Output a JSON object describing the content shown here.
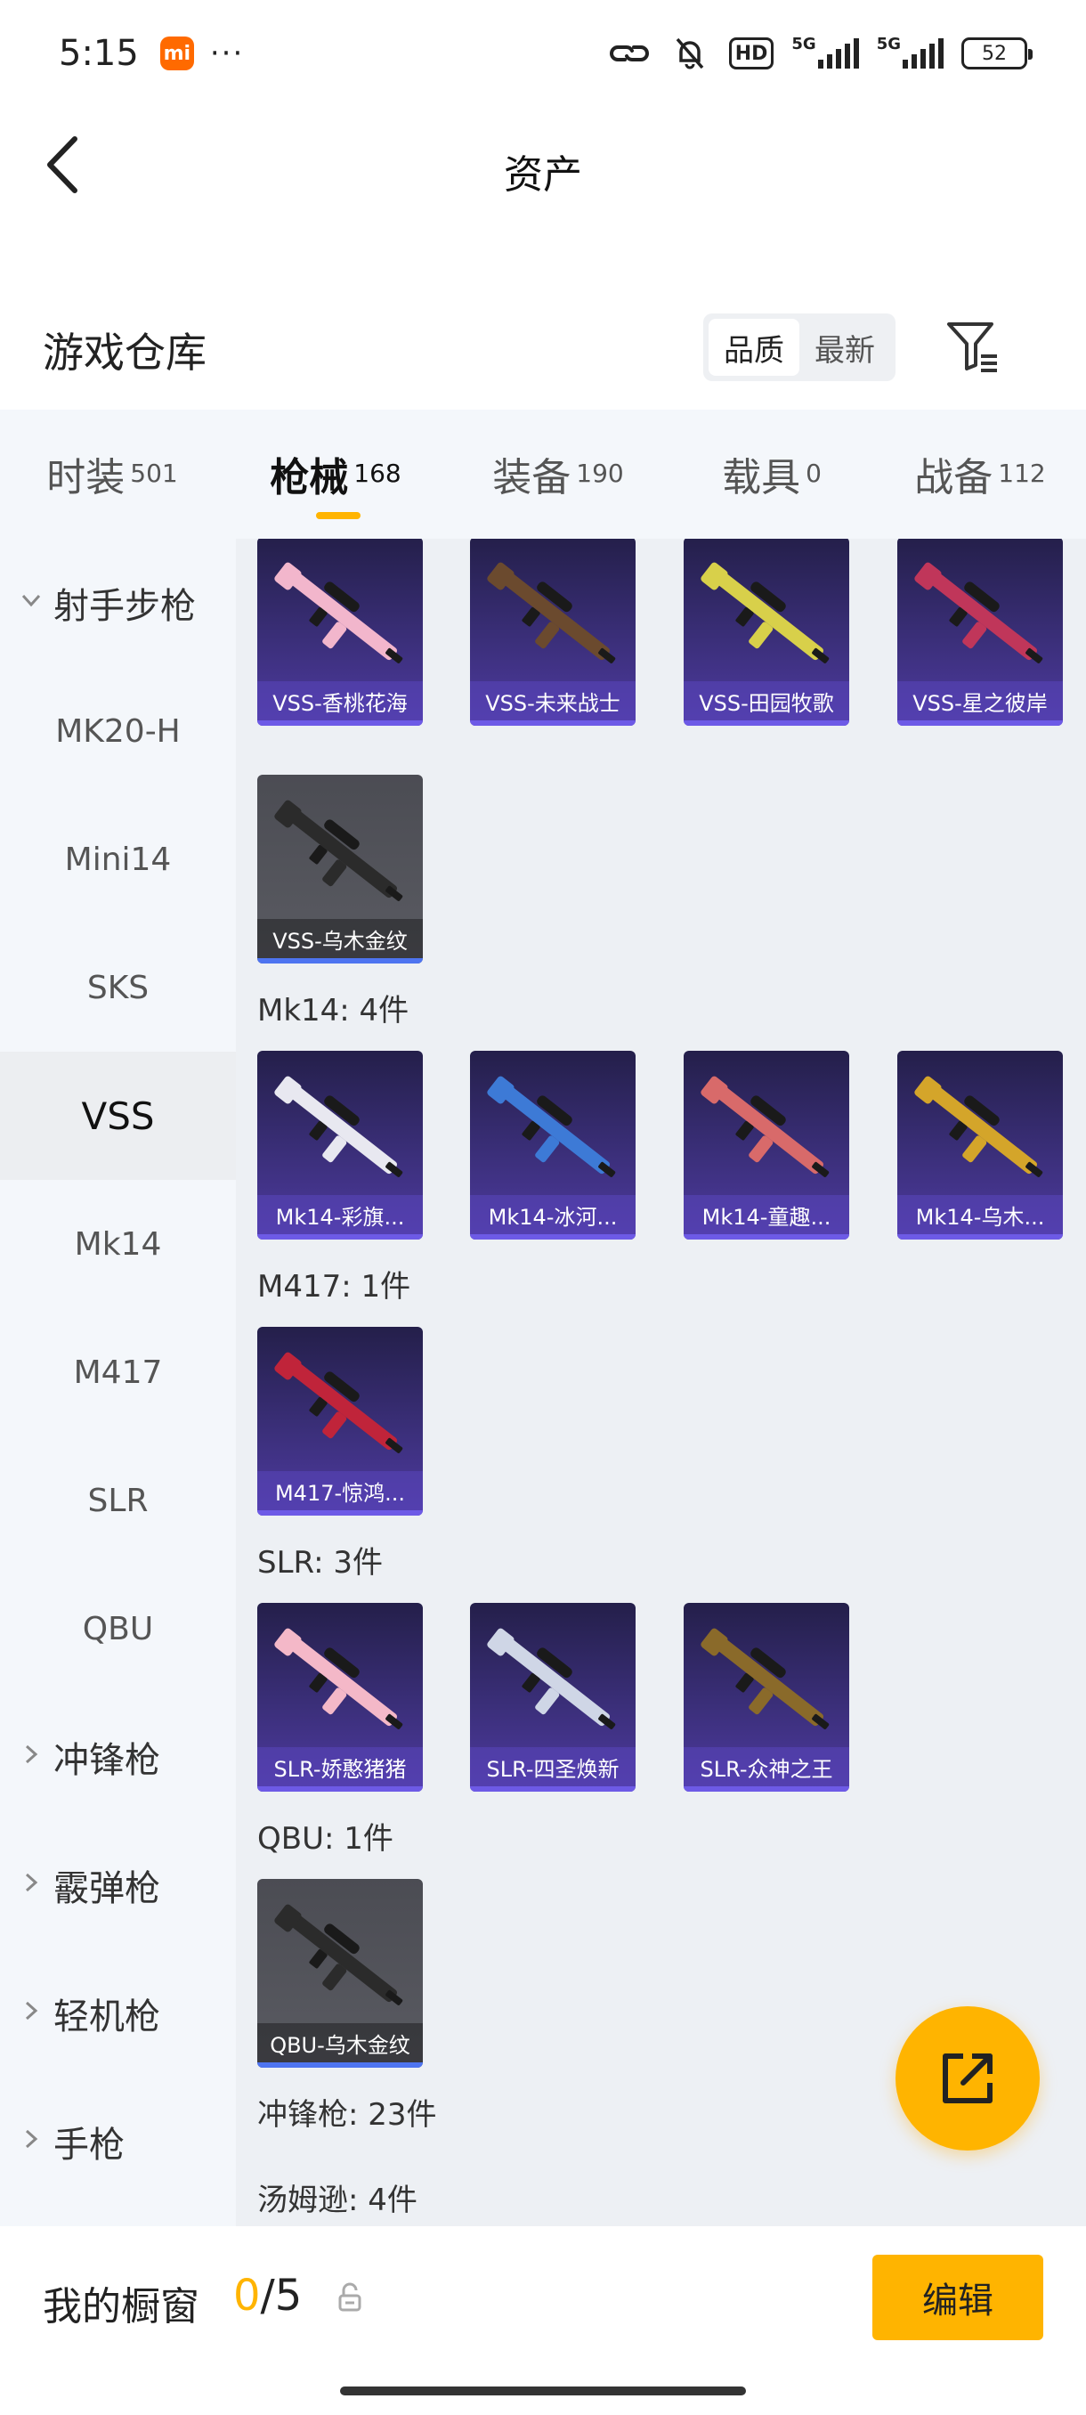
{
  "status": {
    "time": "5:15",
    "mi_badge": "mi",
    "dots": "···",
    "net1": "5G",
    "net2": "5G",
    "hd": "HD",
    "battery": "52"
  },
  "nav": {
    "title": "资产"
  },
  "header": {
    "title": "游戏仓库",
    "sort": [
      "品质",
      "最新"
    ],
    "sort_selected": "品质"
  },
  "tabs": [
    {
      "label": "时装",
      "count": "501"
    },
    {
      "label": "枪械",
      "count": "168",
      "active": true
    },
    {
      "label": "装备",
      "count": "190"
    },
    {
      "label": "载具",
      "count": "0"
    },
    {
      "label": "战备",
      "count": "112"
    }
  ],
  "side": [
    {
      "label": "射手步枪",
      "group": true,
      "expanded": true
    },
    {
      "label": "MK20-H"
    },
    {
      "label": "Mini14"
    },
    {
      "label": "SKS"
    },
    {
      "label": "VSS",
      "active": true
    },
    {
      "label": "Mk14"
    },
    {
      "label": "M417"
    },
    {
      "label": "SLR"
    },
    {
      "label": "QBU"
    },
    {
      "label": "冲锋枪",
      "group": true
    },
    {
      "label": "霰弹枪",
      "group": true
    },
    {
      "label": "轻机枪",
      "group": true
    },
    {
      "label": "手枪",
      "group": true
    }
  ],
  "sections": {
    "mk14": "Mk14: 4件",
    "m417": "M417: 1件",
    "slr": "SLR: 3件",
    "qbu": "QBU: 1件",
    "smg": "冲锋枪: 23件",
    "thompson": "汤姆逊: 4件"
  },
  "items": {
    "vss": [
      "VSS-香桃花海",
      "VSS-未来战士",
      "VSS-田园牧歌",
      "VSS-星之彼岸",
      "VSS-乌木金纹"
    ],
    "mk14": [
      "Mk14-彩旗...",
      "Mk14-冰河...",
      "Mk14-童趣...",
      "Mk14-乌木..."
    ],
    "m417": [
      "M417-惊鸿..."
    ],
    "slr": [
      "SLR-娇憨猪猪",
      "SLR-四圣焕新",
      "SLR-众神之王"
    ],
    "qbu": [
      "QBU-乌木金纹"
    ]
  },
  "gun_colors": {
    "vss": [
      "#f2b6cc",
      "#6b4a2e",
      "#d8d04a",
      "#c0365a",
      "#2b2b2b"
    ],
    "mk14": [
      "#e8e8f0",
      "#3d7ad6",
      "#d86a6a",
      "#d4a52a"
    ],
    "m417": [
      "#c0243a"
    ],
    "slr": [
      "#f4b8c8",
      "#cfd6e6",
      "#8a6a2a"
    ],
    "qbu": [
      "#2b2b2b"
    ]
  },
  "bottom": {
    "title": "我的橱窗",
    "count_num": "0",
    "count_total": "/5",
    "edit": "编辑"
  }
}
